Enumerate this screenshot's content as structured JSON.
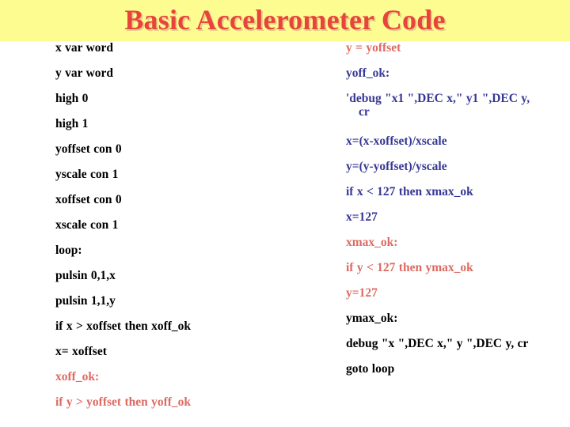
{
  "slide": {
    "title": "Basic Accelerometer Code",
    "title_color": "#e8443c",
    "title_band_color": "#fcfc91",
    "background_color": "#ffffff"
  },
  "palette": {
    "black": "#000000",
    "salmon": "#dd6a62",
    "navy": "#373795"
  },
  "left_column": {
    "lines": [
      {
        "text": "x var word",
        "color": "black"
      },
      {
        "text": "y var word",
        "color": "black"
      },
      {
        "text": "high 0",
        "color": "black"
      },
      {
        "text": "high 1",
        "color": "black"
      },
      {
        "text": "yoffset con 0",
        "color": "black"
      },
      {
        "text": "yscale con 1",
        "color": "black"
      },
      {
        "text": "xoffset con 0",
        "color": "black"
      },
      {
        "text": "xscale con 1",
        "color": "black"
      },
      {
        "text": "loop:",
        "color": "black"
      },
      {
        "text": "pulsin 0,1,x",
        "color": "black"
      },
      {
        "text": "pulsin 1,1,y",
        "color": "black"
      },
      {
        "text": "if x > xoffset then xoff_ok",
        "color": "black"
      },
      {
        "text": "x= xoffset",
        "color": "black"
      },
      {
        "text": "xoff_ok:",
        "color": "salmon"
      },
      {
        "text": "if y > yoffset then yoff_ok",
        "color": "salmon"
      }
    ]
  },
  "right_column": {
    "lines": [
      {
        "text": "y = yoffset",
        "color": "salmon"
      },
      {
        "text": "yoff_ok:",
        "color": "navy"
      },
      {
        "text": "'debug \"x1 \",DEC x,\" y1 \",DEC y,",
        "wrap": "cr",
        "color": "navy"
      },
      {
        "text": "x=(x-xoffset)/xscale",
        "color": "navy"
      },
      {
        "text": "y=(y-yoffset)/yscale",
        "color": "navy"
      },
      {
        "text": "if x < 127 then xmax_ok",
        "color": "navy"
      },
      {
        "text": "x=127",
        "color": "navy"
      },
      {
        "text": "xmax_ok:",
        "color": "salmon"
      },
      {
        "text": "if y < 127 then ymax_ok",
        "color": "salmon"
      },
      {
        "text": "y=127",
        "color": "salmon"
      },
      {
        "text": "ymax_ok:",
        "color": "black"
      },
      {
        "text": "debug \"x \",DEC x,\" y \",DEC y, cr",
        "color": "black"
      },
      {
        "text": "goto loop",
        "color": "black"
      }
    ]
  }
}
